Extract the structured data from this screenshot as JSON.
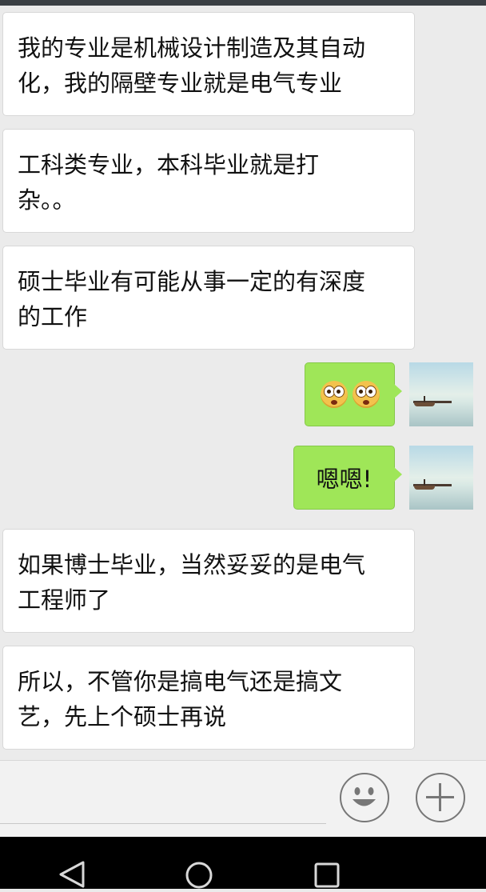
{
  "chat": {
    "messages": [
      {
        "direction": "incoming",
        "lines": [
          "我的专业是机械设计制造及其自动",
          "化，我的隔壁专业就是电气专业"
        ]
      },
      {
        "direction": "incoming",
        "lines": [
          "工科类专业，本科毕业就是打",
          "杂。。"
        ]
      },
      {
        "direction": "incoming",
        "lines": [
          "硕士毕业有可能从事一定的有深度",
          "的工作"
        ]
      },
      {
        "direction": "outgoing",
        "content": "emoji",
        "emoji": [
          "dizzy-face-emoji",
          "dizzy-face-emoji"
        ]
      },
      {
        "direction": "outgoing",
        "text": "嗯嗯!"
      },
      {
        "direction": "incoming",
        "lines": [
          "如果博士毕业，当然妥妥的是电气",
          "工程师了"
        ]
      },
      {
        "direction": "incoming",
        "lines": [
          "所以，不管你是搞电气还是搞文",
          "艺，先上个硕士再说"
        ]
      }
    ]
  },
  "input_bar": {
    "icons": [
      "emoji-smiley-icon",
      "plus-icon"
    ]
  },
  "nav_bar": {
    "icons": [
      "back-triangle-icon",
      "home-circle-icon",
      "recents-square-icon"
    ]
  },
  "colors": {
    "chat_background": "#ebebeb",
    "incoming_bubble": "#ffffff",
    "outgoing_bubble": "#9fe658",
    "nav_background": "#000000"
  }
}
